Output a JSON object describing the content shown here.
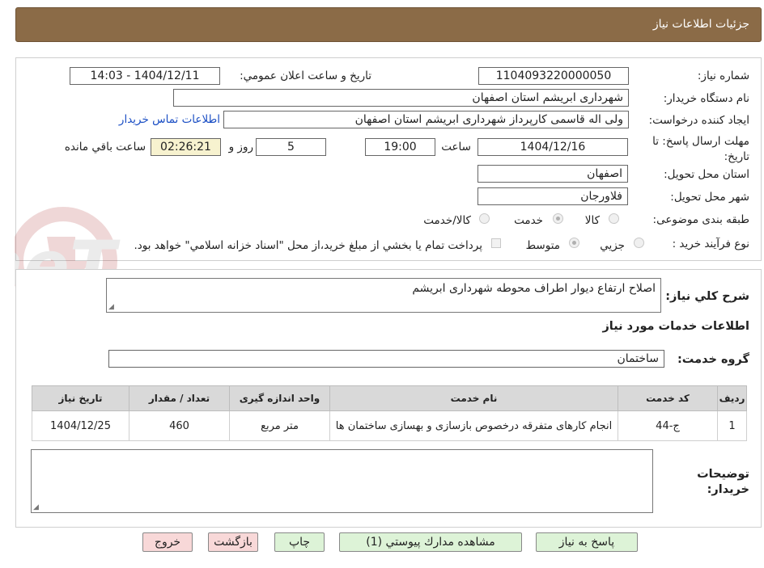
{
  "header": {
    "title": "جزئيات اطلاعات نياز"
  },
  "form": {
    "need_number_label": "شماره نياز:",
    "need_number": "1104093220000050",
    "announce_label": "تاريخ و ساعت اعلان عمومي:",
    "announce_value": "1404/12/11 - 14:03",
    "buyer_org_label": "نام دستگاه خريدار:",
    "buyer_org": "شهرداری ابریشم استان اصفهان",
    "requester_label": "ايجاد كننده درخواست:",
    "requester": "ولی اله قاسمی کارپرداز شهرداری ابریشم استان اصفهان",
    "contact_link": "اطلاعات تماس خريدار",
    "deadline_label": "مهلت ارسال پاسخ: تا تاريخ:",
    "deadline_date": "1404/12/16",
    "time_label": "ساعت",
    "deadline_time": "19:00",
    "days_value": "5",
    "days_label": "روز و",
    "remaining_time": "02:26:21",
    "remaining_label": "ساعت باقي مانده",
    "province_label": "استان محل تحويل:",
    "province": "اصفهان",
    "city_label": "شهر محل تحويل:",
    "city": "فلاورجان",
    "category_label": "طبقه بندی موضوعی:",
    "category_options": [
      "كالا",
      "خدمت",
      "كالا/خدمت"
    ],
    "category_selected": "خدمت",
    "process_label": "نوع فرآيند خريد :",
    "process_options": [
      "جزيي",
      "متوسط"
    ],
    "process_selected": "متوسط",
    "payment_note": "پرداخت تمام يا بخشي از مبلغ خريد،از محل \"اسناد خزانه اسلامي\" خواهد بود."
  },
  "details": {
    "description_label": "شرح كلي نياز:",
    "description": "اصلاح ارتفاع دیوار اطراف محوطه شهرداری ابریشم",
    "services_heading": "اطلاعات خدمات مورد نياز",
    "service_group_label": "گروه خدمت:",
    "service_group": "ساختمان",
    "table": {
      "headers": [
        "رديف",
        "كد خدمت",
        "نام خدمت",
        "واحد اندازه گيری",
        "تعداد / مقدار",
        "تاريخ نياز"
      ],
      "rows": [
        [
          "1",
          "ج-44",
          "انجام کارهای متفرقه درخصوص بازسازی و بهسازی ساختمان ها",
          "متر مربع",
          "460",
          "1404/12/25"
        ]
      ]
    },
    "buyer_notes_label": "توضيحات خريدار:",
    "buyer_notes": ""
  },
  "buttons": {
    "reply": "پاسخ به نياز",
    "attachments": "مشاهده مدارك پيوستي (1)",
    "print": "چاپ",
    "back": "بازگشت",
    "exit": "خروج"
  },
  "watermark": {
    "brand": "AriaTender.neT"
  }
}
